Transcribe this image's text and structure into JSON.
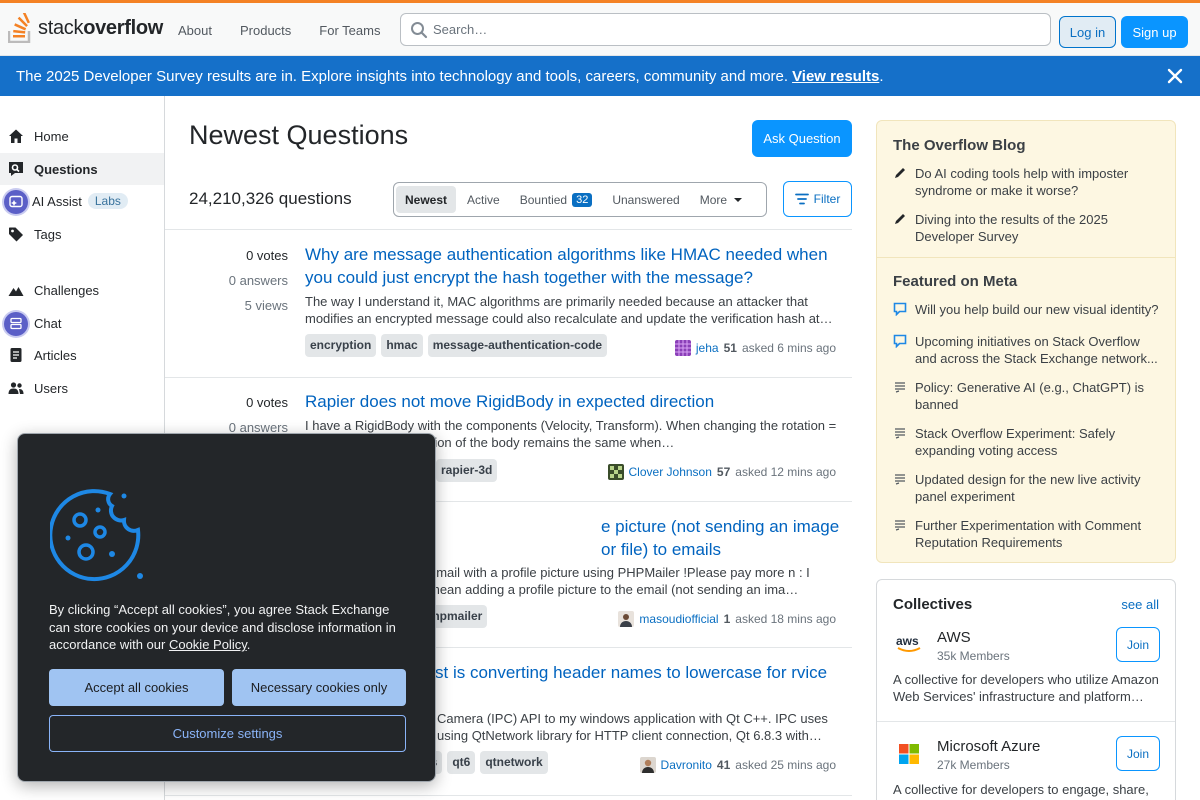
{
  "header": {
    "logo_word1": "stack",
    "logo_word2": "overflow",
    "nav": [
      "About",
      "Products",
      "For Teams"
    ],
    "search_placeholder": "Search…",
    "login": "Log in",
    "signup": "Sign up"
  },
  "banner": {
    "text": "The 2025 Developer Survey results are in. Explore insights into technology and tools, careers, community and more.",
    "link": "View results",
    "trail": "."
  },
  "sidebar": {
    "items": [
      {
        "label": "Home",
        "icon": "home-icon"
      },
      {
        "label": "Questions",
        "icon": "questions-icon"
      },
      {
        "label": "AI Assist",
        "icon": "ai-assist-icon",
        "badge": "Labs"
      },
      {
        "label": "Tags",
        "icon": "tag-icon"
      },
      {
        "label": "Challenges",
        "icon": "challenges-icon"
      },
      {
        "label": "Chat",
        "icon": "chat-icon"
      },
      {
        "label": "Articles",
        "icon": "articles-icon"
      },
      {
        "label": "Users",
        "icon": "users-icon"
      }
    ]
  },
  "main": {
    "title": "Newest Questions",
    "ask_button": "Ask Question",
    "count": "24,210,326 questions",
    "tabs": {
      "newest": "Newest",
      "active": "Active",
      "bountied": "Bountied",
      "bountied_count": "32",
      "unanswered": "Unanswered",
      "more": "More"
    },
    "filter": "Filter",
    "questions": [
      {
        "votes": "0 votes",
        "answers": "0 answers",
        "views": "5 views",
        "title": "Why are message authentication algorithms like HMAC needed when you could just encrypt the hash together with the message?",
        "excerpt": "The way I understand it, MAC algorithms are primarily needed because an attacker that modifies an encrypted message could also recalculate and update the verification hash at…",
        "tags": [
          "encryption",
          "hmac",
          "message-authentication-code"
        ],
        "user": "jeha",
        "rep": "51",
        "asked": "asked 6 mins ago"
      },
      {
        "votes": "0 votes",
        "answers": "0 answers",
        "views": "",
        "title": "Rapier does not move RigidBody in expected direction",
        "excerpt": "I have a RigidBody with the components (Velocity, Transform). When changing the rotation = …, the “forward” direction of the body remains the same when…",
        "tags": [
          "rapier-3d"
        ],
        "user": "Clover Johnson",
        "rep": "57",
        "asked": "asked 12 mins ago"
      },
      {
        "votes": "",
        "answers": "",
        "views": "",
        "title": "e picture (not sending an image or file) to emails",
        "excerpt": "email with a profile picture using PHPMailer !Please pay more n : I mean adding a profile picture to the email (not sending an ima…",
        "tags": [
          "phpmailer"
        ],
        "user": "masoudiofficial",
        "rep": "1",
        "asked": "asked 18 mins ago"
      },
      {
        "votes": "",
        "answers": "",
        "views": "",
        "title": "st is converting header names to lowercase for rvice",
        "excerpt": "Camera (IPC) API to my windows application with Qt C++. IPC uses using QtNetwork library for HTTP client connection, Qt 6.8.3 with…",
        "tags": [
          "rs",
          "qt6",
          "qtnetwork"
        ],
        "user": "Davronito",
        "rep": "41",
        "asked": "asked 25 mins ago"
      }
    ]
  },
  "blog": {
    "heading": "The Overflow Blog",
    "posts": [
      "Do AI coding tools help with imposter syndrome or make it worse?",
      "Diving into the results of the 2025 Developer Survey"
    ],
    "meta_heading": "Featured on Meta",
    "meta": [
      "Will you help build our new visual identity?",
      "Upcoming initiatives on Stack Overflow and across the Stack Exchange network...",
      "Policy: Generative AI (e.g., ChatGPT) is banned",
      "Stack Overflow Experiment: Safely expanding voting access",
      "Updated design for the new live activity panel experiment",
      "Further Experimentation with Comment Reputation Requirements"
    ]
  },
  "collectives": {
    "heading": "Collectives",
    "see_all": "see all",
    "items": [
      {
        "name": "AWS",
        "members": "35k Members",
        "join": "Join",
        "desc": "A collective for developers who utilize Amazon Web Services' infrastructure and platform…",
        "logo_text": "aws"
      },
      {
        "name": "Microsoft Azure",
        "members": "27k Members",
        "join": "Join",
        "desc": "A collective for developers to engage, share,"
      }
    ]
  },
  "cookie": {
    "text_before": "By clicking “Accept all cookies”, you agree Stack Exchange can store cookies on your device and disclose information in accordance with our ",
    "policy_link": "Cookie Policy",
    "text_after": ".",
    "accept": "Accept all cookies",
    "necessary": "Necessary cookies only",
    "customize": "Customize settings"
  },
  "colors": {
    "accent": "#f48225",
    "brand_blue": "#0a95ff",
    "banner": "#1570c9",
    "link": "#0063bf"
  }
}
